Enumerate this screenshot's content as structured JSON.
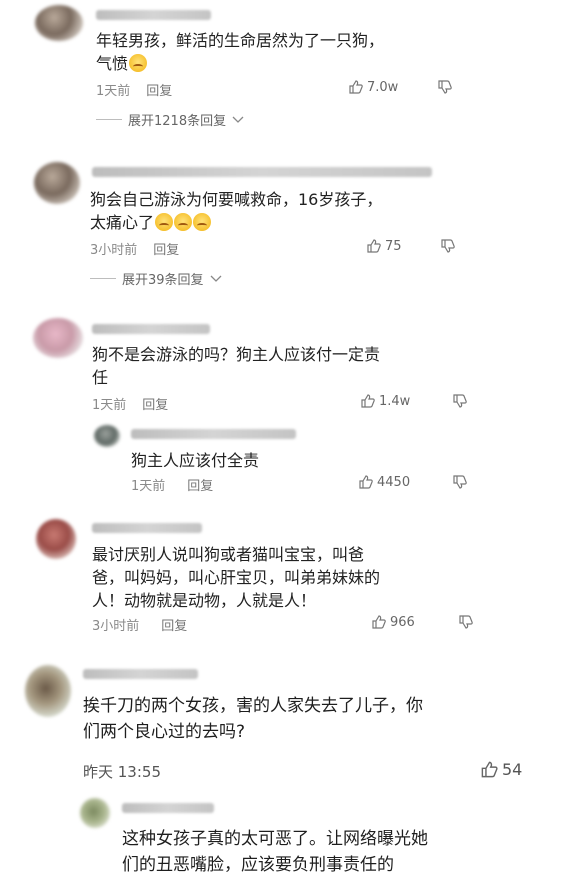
{
  "comments": [
    {
      "text_line1": "年轻男孩，鲜活的生命居然为了一只狗，",
      "text_line2": "气愤",
      "time": "1天前",
      "reply_label": "回复",
      "likes": "7.0w",
      "expand_label": "展开1218条回复"
    },
    {
      "text_line1": "狗会自己游泳为何要喊救命，16岁孩子，",
      "text_line2": "太痛心了",
      "time": "3小时前",
      "reply_label": "回复",
      "likes": "75",
      "expand_label": "展开39条回复"
    },
    {
      "text_line1": "狗不是会游泳的吗？狗主人应该付一定责",
      "text_line2": "任",
      "time": "1天前",
      "reply_label": "回复",
      "likes": "1.4w",
      "sub_reply": {
        "text": "狗主人应该付全责",
        "time": "1天前",
        "reply_label": "回复",
        "likes": "4450"
      }
    },
    {
      "text_line1": "最讨厌别人说叫狗或者猫叫宝宝，叫爸",
      "text_line2": "爸，叫妈妈，叫心肝宝贝，叫弟弟妹妹的",
      "text_line3": "人！动物就是动物，人就是人！",
      "time": "3小时前",
      "reply_label": "回复",
      "likes": "966"
    },
    {
      "text_line1": "挨千刀的两个女孩，害的人家失去了儿子，你",
      "text_line2": "们两个良心过的去吗?",
      "time": "昨天 13:55",
      "likes": "54",
      "sub_reply": {
        "text_line1": "这种女孩子真的太可恶了。让网络曝光她",
        "text_line2": "们的丑恶嘴脸，应该要负刑事责任的"
      }
    }
  ],
  "icons": {
    "like": "thumbs-up-icon",
    "dislike": "thumbs-down-icon",
    "expand": "chevron-down-icon",
    "emoji": "pleading-face-emoji"
  }
}
